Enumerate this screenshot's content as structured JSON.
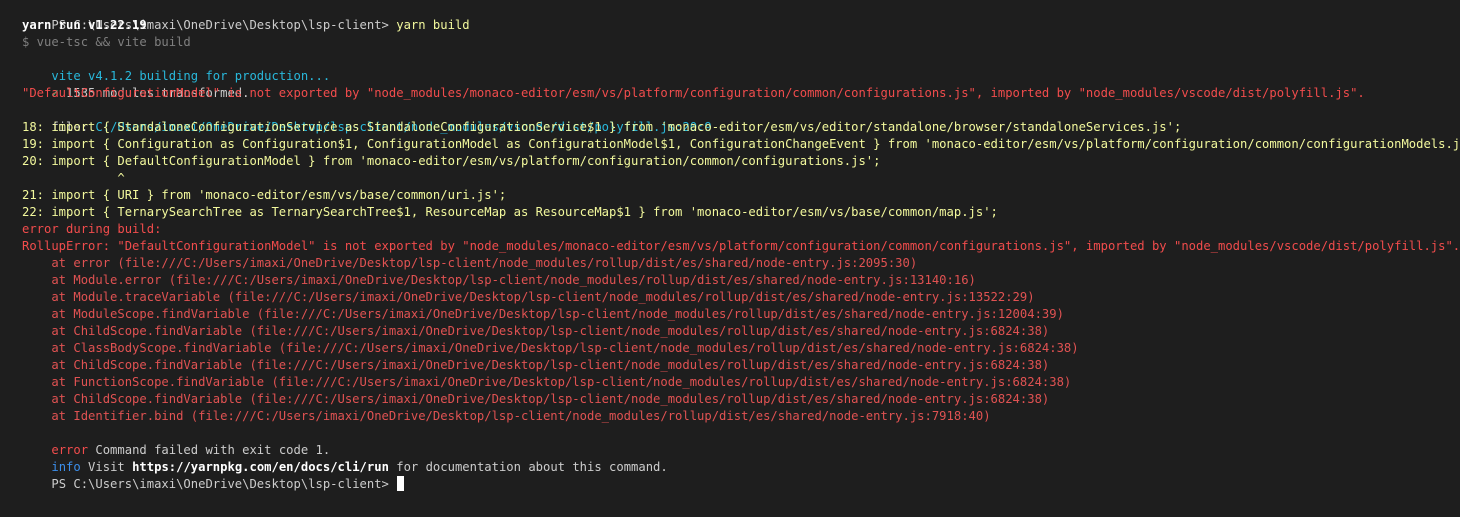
{
  "terminal": {
    "prompt": "PS C:\\Users\\imaxi\\OneDrive\\Desktop\\lsp-client> ",
    "command": "yarn build",
    "yarn_run": "yarn run v1.22.19",
    "script_cmd": "$ vue-tsc && vite build",
    "vite_building": "vite v4.1.2 building for production...",
    "transformed_check": "✓",
    "transformed_text": " 1535 modules transformed.",
    "export_error": "\"DefaultConfigurationModel\" is not exported by \"node_modules/monaco-editor/esm/vs/platform/configuration/common/configurations.js\", imported by \"node_modules/vscode/dist/polyfill.js\".",
    "file_label": "file: ",
    "file_path": "C:/Users/imaxi/OneDrive/Desktop/lsp-client/node_modules/vscode/dist/polyfill.js:20:9",
    "code_lines": [
      "18: import { StandaloneConfigurationService as StandaloneConfigurationService$1 } from 'monaco-editor/esm/vs/editor/standalone/browser/standaloneServices.js';",
      "19: import { Configuration as Configuration$1, ConfigurationModel as ConfigurationModel$1, ConfigurationChangeEvent } from 'monaco-editor/esm/vs/platform/configuration/common/configurationModels.js';",
      "20: import { DefaultConfigurationModel } from 'monaco-editor/esm/vs/platform/configuration/common/configurations.js';",
      "             ^",
      "21: import { URI } from 'monaco-editor/esm/vs/base/common/uri.js';",
      "22: import { TernarySearchTree as TernarySearchTree$1, ResourceMap as ResourceMap$1 } from 'monaco-editor/esm/vs/base/common/map.js';"
    ],
    "error_during_build": "error during build:",
    "rollup_error": "RollupError: \"DefaultConfigurationModel\" is not exported by \"node_modules/monaco-editor/esm/vs/platform/configuration/common/configurations.js\", imported by \"node_modules/vscode/dist/polyfill.js\".",
    "stack": [
      "    at error (file:///C:/Users/imaxi/OneDrive/Desktop/lsp-client/node_modules/rollup/dist/es/shared/node-entry.js:2095:30)",
      "    at Module.error (file:///C:/Users/imaxi/OneDrive/Desktop/lsp-client/node_modules/rollup/dist/es/shared/node-entry.js:13140:16)",
      "    at Module.traceVariable (file:///C:/Users/imaxi/OneDrive/Desktop/lsp-client/node_modules/rollup/dist/es/shared/node-entry.js:13522:29)",
      "    at ModuleScope.findVariable (file:///C:/Users/imaxi/OneDrive/Desktop/lsp-client/node_modules/rollup/dist/es/shared/node-entry.js:12004:39)",
      "    at ChildScope.findVariable (file:///C:/Users/imaxi/OneDrive/Desktop/lsp-client/node_modules/rollup/dist/es/shared/node-entry.js:6824:38)",
      "    at ClassBodyScope.findVariable (file:///C:/Users/imaxi/OneDrive/Desktop/lsp-client/node_modules/rollup/dist/es/shared/node-entry.js:6824:38)",
      "    at ChildScope.findVariable (file:///C:/Users/imaxi/OneDrive/Desktop/lsp-client/node_modules/rollup/dist/es/shared/node-entry.js:6824:38)",
      "    at FunctionScope.findVariable (file:///C:/Users/imaxi/OneDrive/Desktop/lsp-client/node_modules/rollup/dist/es/shared/node-entry.js:6824:38)",
      "    at ChildScope.findVariable (file:///C:/Users/imaxi/OneDrive/Desktop/lsp-client/node_modules/rollup/dist/es/shared/node-entry.js:6824:38)",
      "    at Identifier.bind (file:///C:/Users/imaxi/OneDrive/Desktop/lsp-client/node_modules/rollup/dist/es/shared/node-entry.js:7918:40)"
    ],
    "error_label": "error",
    "error_text": " Command failed with exit code 1.",
    "info_label": "info",
    "info_visit": " Visit ",
    "info_url": "https://yarnpkg.com/en/docs/cli/run",
    "info_rest": " for documentation about this command.",
    "final_prompt": "PS C:\\Users\\imaxi\\OneDrive\\Desktop\\lsp-client> "
  },
  "colors": {
    "background": "#1e1e1e",
    "text": "#cccccc",
    "error": "#f14c4c",
    "info": "#3b8eea",
    "code": "#f3f99d",
    "vite": "#29b8db",
    "success": "#23d18b"
  }
}
